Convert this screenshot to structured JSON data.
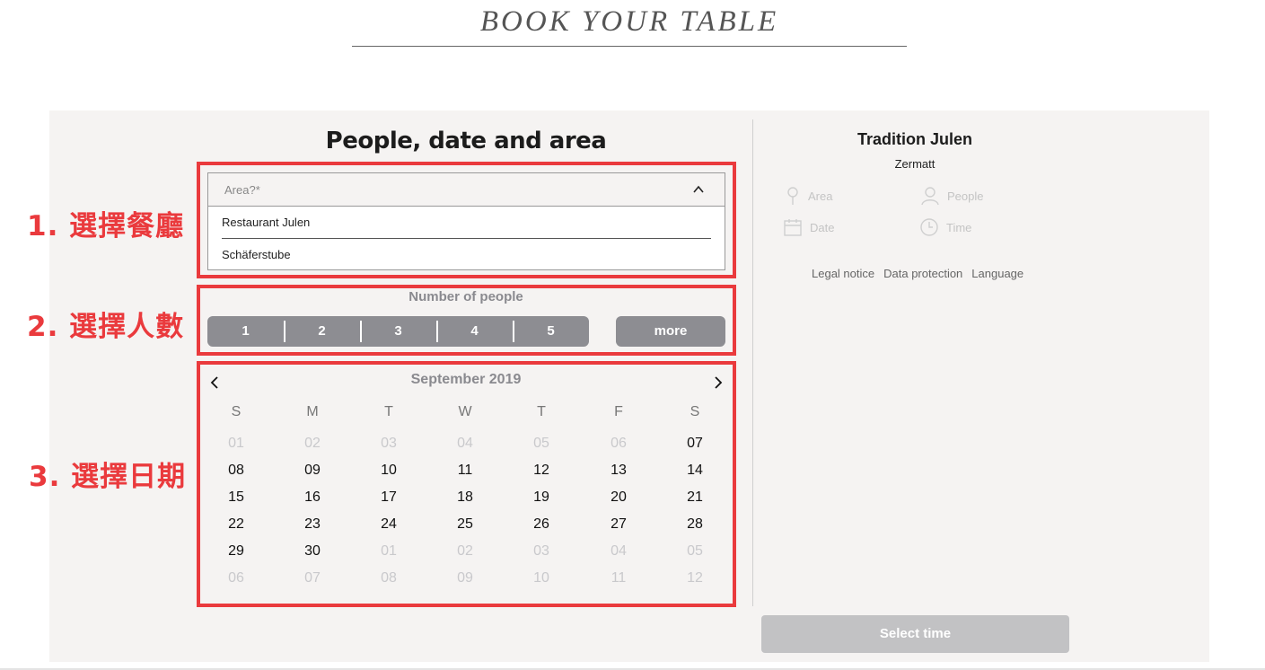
{
  "page_title": "BOOK YOUR TABLE",
  "section_heading": "People, date and area",
  "annotations": [
    {
      "label": "1. 選擇餐廳"
    },
    {
      "label": "2. 選擇人數"
    },
    {
      "label": "3. 選擇日期"
    }
  ],
  "area_select": {
    "placeholder": "Area?*",
    "options": [
      "Restaurant Julen",
      "Schäferstube"
    ]
  },
  "people": {
    "label": "Number of people",
    "options": [
      "1",
      "2",
      "3",
      "4",
      "5"
    ],
    "more_label": "more"
  },
  "calendar": {
    "month_label": "September 2019",
    "weekdays": [
      "S",
      "M",
      "T",
      "W",
      "T",
      "F",
      "S"
    ],
    "weeks": [
      [
        {
          "d": "01",
          "m": true
        },
        {
          "d": "02",
          "m": true
        },
        {
          "d": "03",
          "m": true
        },
        {
          "d": "04",
          "m": true
        },
        {
          "d": "05",
          "m": true
        },
        {
          "d": "06",
          "m": true
        },
        {
          "d": "07",
          "m": false
        }
      ],
      [
        {
          "d": "08",
          "m": false
        },
        {
          "d": "09",
          "m": false
        },
        {
          "d": "10",
          "m": false
        },
        {
          "d": "11",
          "m": false
        },
        {
          "d": "12",
          "m": false
        },
        {
          "d": "13",
          "m": false
        },
        {
          "d": "14",
          "m": false
        }
      ],
      [
        {
          "d": "15",
          "m": false
        },
        {
          "d": "16",
          "m": false
        },
        {
          "d": "17",
          "m": false
        },
        {
          "d": "18",
          "m": false
        },
        {
          "d": "19",
          "m": false
        },
        {
          "d": "20",
          "m": false
        },
        {
          "d": "21",
          "m": false
        }
      ],
      [
        {
          "d": "22",
          "m": false
        },
        {
          "d": "23",
          "m": false
        },
        {
          "d": "24",
          "m": false
        },
        {
          "d": "25",
          "m": false
        },
        {
          "d": "26",
          "m": false
        },
        {
          "d": "27",
          "m": false
        },
        {
          "d": "28",
          "m": false
        }
      ],
      [
        {
          "d": "29",
          "m": false
        },
        {
          "d": "30",
          "m": false
        },
        {
          "d": "01",
          "m": true
        },
        {
          "d": "02",
          "m": true
        },
        {
          "d": "03",
          "m": true
        },
        {
          "d": "04",
          "m": true
        },
        {
          "d": "05",
          "m": true
        }
      ],
      [
        {
          "d": "06",
          "m": true
        },
        {
          "d": "07",
          "m": true
        },
        {
          "d": "08",
          "m": true
        },
        {
          "d": "09",
          "m": true
        },
        {
          "d": "10",
          "m": true
        },
        {
          "d": "11",
          "m": true
        },
        {
          "d": "12",
          "m": true
        }
      ]
    ]
  },
  "summary": {
    "restaurant_name": "Tradition Julen",
    "city": "Zermatt",
    "area_label": "Area",
    "people_label": "People",
    "date_label": "Date",
    "time_label": "Time"
  },
  "footer": {
    "legal_notice": "Legal notice",
    "data_protection": "Data protection",
    "language": "Language"
  },
  "select_time_label": "Select time",
  "colors": {
    "accent_red": "#ea3a3d",
    "button_gray": "#8d8d92",
    "panel_bg": "#f5f3f2",
    "disabled_button": "#c2c2c4"
  },
  "icons": [
    "chevron-up-icon",
    "chevron-left-icon",
    "chevron-right-icon",
    "location-pin-icon",
    "person-icon",
    "calendar-icon",
    "clock-icon"
  ]
}
